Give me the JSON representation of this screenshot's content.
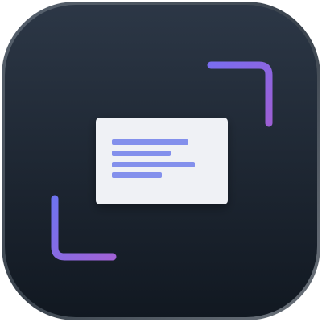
{
  "icon": {
    "semantic": "screen-capture-app-icon",
    "background_color_top": "#2c3746",
    "background_color_bottom": "#111821",
    "rim_color": "#6b7280",
    "corner_bracket_gradient_start": "#7f6ae9",
    "corner_bracket_gradient_end": "#9b63d6",
    "card_color": "#eff1f5",
    "text_line_color": "#8390ec",
    "card_text_line_count": 4
  }
}
